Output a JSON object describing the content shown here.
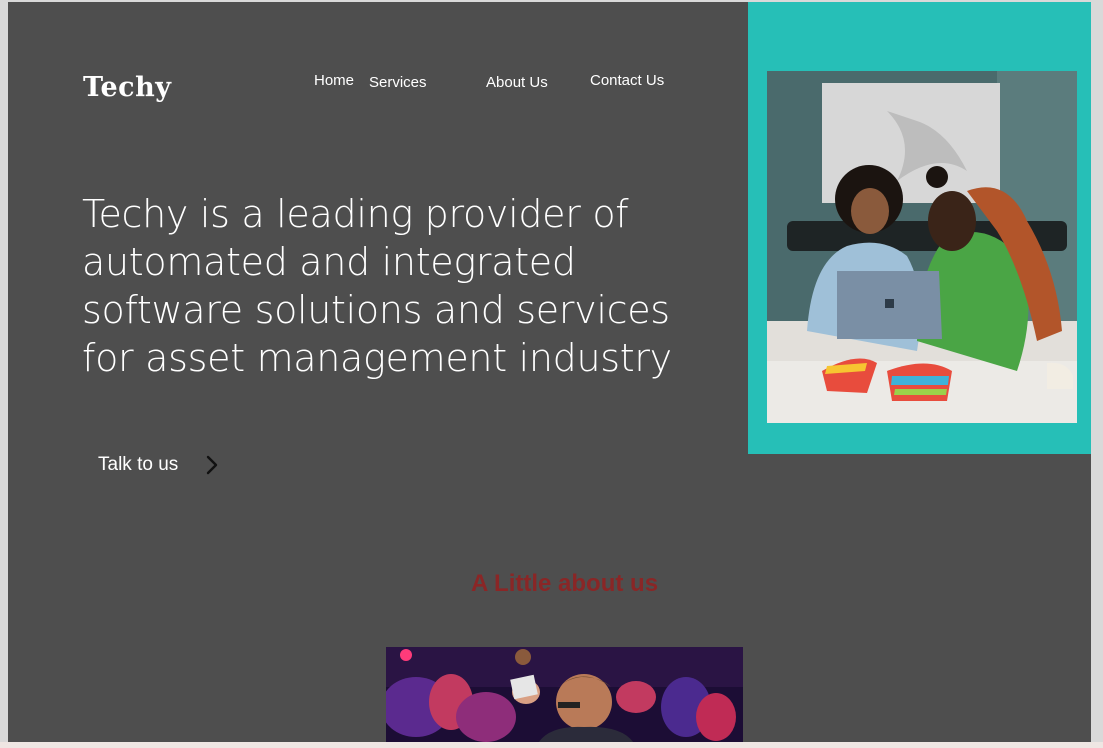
{
  "brand": {
    "logo": "Techy"
  },
  "nav": {
    "home": "Home",
    "services": "Services",
    "about": "About Us",
    "contact": "Contact Us"
  },
  "hero": {
    "headline_lines": [
      "Techy is a leading provider of",
      "automated and integrated",
      "software solutions and services",
      "for asset management industry"
    ],
    "cta_label": "Talk to us"
  },
  "about": {
    "title": "A Little about us"
  },
  "colors": {
    "page_bg": "#4e4e4e",
    "accent_teal": "#26bfb7",
    "about_title": "#8a2626",
    "text": "#ffffff"
  },
  "icons": {
    "cta": "chevron-right-icon"
  }
}
